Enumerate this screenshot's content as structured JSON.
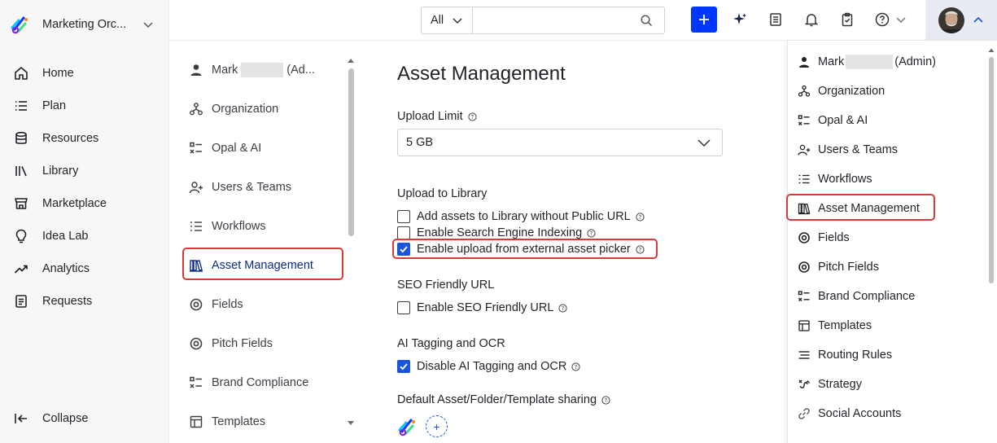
{
  "workspace": {
    "name": "Marketing Orc..."
  },
  "left_nav": {
    "items": [
      {
        "label": "Home",
        "icon": "home-icon"
      },
      {
        "label": "Plan",
        "icon": "list-icon"
      },
      {
        "label": "Resources",
        "icon": "database-icon"
      },
      {
        "label": "Library",
        "icon": "library-icon"
      },
      {
        "label": "Marketplace",
        "icon": "store-icon"
      },
      {
        "label": "Idea Lab",
        "icon": "lightbulb-icon"
      },
      {
        "label": "Analytics",
        "icon": "trend-icon"
      },
      {
        "label": "Requests",
        "icon": "document-icon"
      }
    ],
    "collapse_label": "Collapse"
  },
  "topbar": {
    "filter_label": "All",
    "search_placeholder": "",
    "icons": [
      "plus-icon",
      "sparkle-icon",
      "notes-icon",
      "bell-icon",
      "clipboard-icon",
      "help-icon",
      "avatar"
    ]
  },
  "settings_nav": {
    "user_name": "Mark",
    "user_suffix": "(Ad...",
    "items": [
      {
        "label": "Organization",
        "icon": "organization-icon"
      },
      {
        "label": "Opal & AI",
        "icon": "opal-icon"
      },
      {
        "label": "Users & Teams",
        "icon": "users-icon"
      },
      {
        "label": "Workflows",
        "icon": "workflows-icon"
      },
      {
        "label": "Asset Management",
        "icon": "asset-icon",
        "active": true
      },
      {
        "label": "Fields",
        "icon": "fields-icon"
      },
      {
        "label": "Pitch Fields",
        "icon": "pitch-fields-icon"
      },
      {
        "label": "Brand Compliance",
        "icon": "brand-compliance-icon"
      },
      {
        "label": "Templates",
        "icon": "templates-icon"
      }
    ]
  },
  "main": {
    "title": "Asset Management",
    "upload_limit": {
      "label": "Upload Limit",
      "value": "5 GB"
    },
    "upload_to_library": {
      "label": "Upload to Library",
      "options": [
        {
          "label": "Add assets to Library without Public URL",
          "checked": false
        },
        {
          "label": "Enable Search Engine Indexing",
          "checked": false
        },
        {
          "label": "Enable upload from external asset picker",
          "checked": true
        }
      ]
    },
    "seo": {
      "label": "SEO Friendly URL",
      "option": {
        "label": "Enable SEO Friendly URL",
        "checked": false
      }
    },
    "ai_tagging": {
      "label": "AI Tagging and OCR",
      "option": {
        "label": "Disable AI Tagging and OCR",
        "checked": true
      }
    },
    "sharing": {
      "label": "Default Asset/Folder/Template sharing",
      "add_symbol": "+"
    }
  },
  "dropdown": {
    "user_name": "Mark",
    "user_suffix": "(Admin)",
    "items": [
      {
        "label": "Organization",
        "icon": "organization-icon"
      },
      {
        "label": "Opal & AI",
        "icon": "opal-icon"
      },
      {
        "label": "Users & Teams",
        "icon": "users-icon"
      },
      {
        "label": "Workflows",
        "icon": "workflows-icon"
      },
      {
        "label": "Asset Management",
        "icon": "asset-icon",
        "highlighted": true
      },
      {
        "label": "Fields",
        "icon": "fields-icon"
      },
      {
        "label": "Pitch Fields",
        "icon": "pitch-fields-icon"
      },
      {
        "label": "Brand Compliance",
        "icon": "brand-compliance-icon"
      },
      {
        "label": "Templates",
        "icon": "templates-icon"
      },
      {
        "label": "Routing Rules",
        "icon": "routing-rules-icon"
      },
      {
        "label": "Strategy",
        "icon": "strategy-icon"
      },
      {
        "label": "Social Accounts",
        "icon": "link-icon"
      }
    ]
  },
  "colors": {
    "accent": "#0037ff",
    "checkbox": "#1a56db",
    "highlight": "#d93a3a"
  }
}
